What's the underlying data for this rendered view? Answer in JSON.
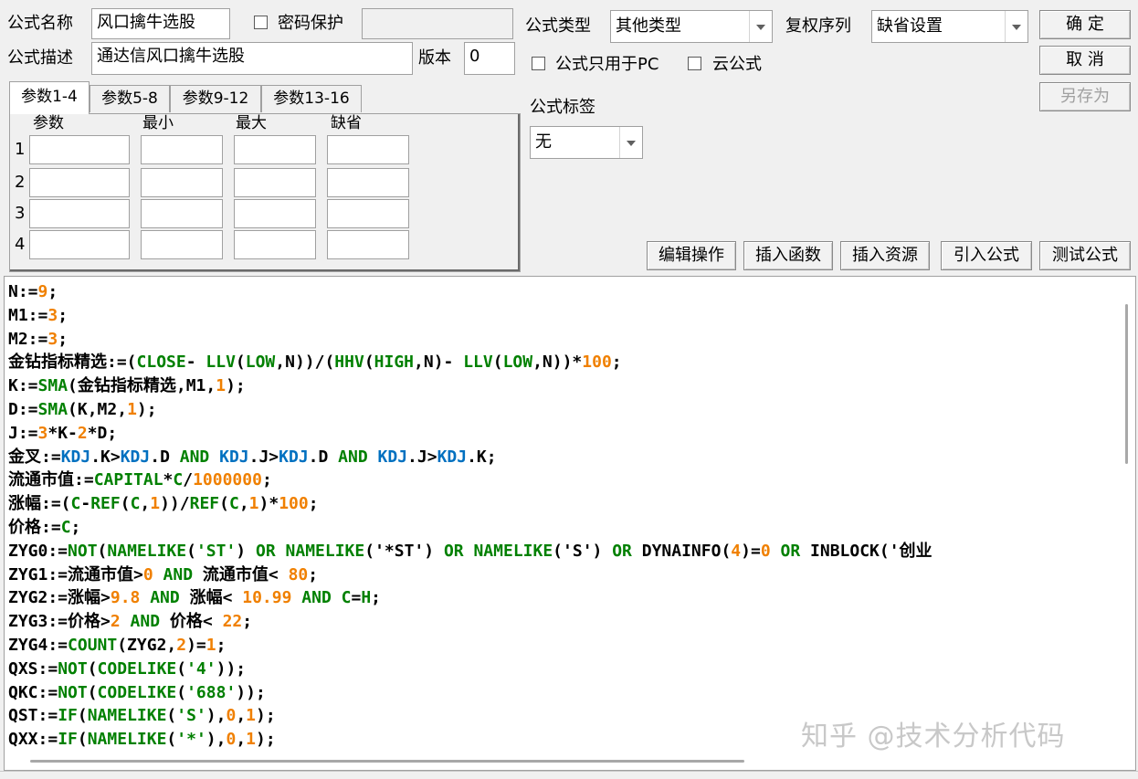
{
  "form": {
    "name_label": "公式名称",
    "name_value": "风口擒牛选股",
    "password_label": "密码保护",
    "password_checked": false,
    "password_value": "",
    "desc_label": "公式描述",
    "desc_value": "通达信风口擒牛选股",
    "version_label": "版本",
    "version_value": "0",
    "type_label": "公式类型",
    "type_value": "其他类型",
    "rights_label": "复权序列",
    "rights_value": "缺省设置",
    "pc_only_label": "公式只用于PC",
    "pc_only_checked": false,
    "cloud_label": "云公式",
    "cloud_checked": false,
    "tag_label": "公式标签",
    "tag_value": "无"
  },
  "buttons": {
    "ok": "确 定",
    "cancel": "取 消",
    "save_as": "另存为",
    "edit_ops": "编辑操作",
    "insert_func": "插入函数",
    "insert_res": "插入资源",
    "import_formula": "引入公式",
    "test_formula": "测试公式"
  },
  "tabs": [
    "参数1-4",
    "参数5-8",
    "参数9-12",
    "参数13-16"
  ],
  "params": {
    "headers": [
      "参数",
      "最小",
      "最大",
      "缺省"
    ],
    "rows": [
      "1",
      "2",
      "3",
      "4"
    ]
  },
  "colors": {
    "default": "#000000",
    "number": "#f08000",
    "function": "#008000",
    "keyword": "#008000",
    "variable": "#0070c0",
    "string": "#008000"
  },
  "code_lines": [
    [
      [
        "N:=",
        "default"
      ],
      [
        "9",
        "number"
      ],
      [
        ";",
        "default"
      ]
    ],
    [
      [
        "M1:=",
        "default"
      ],
      [
        "3",
        "number"
      ],
      [
        ";",
        "default"
      ]
    ],
    [
      [
        "M2:=",
        "default"
      ],
      [
        "3",
        "number"
      ],
      [
        ";",
        "default"
      ]
    ],
    [
      [
        "金钻指标精选:=(",
        "default"
      ],
      [
        "CLOSE",
        "function"
      ],
      [
        "- ",
        "default"
      ],
      [
        "LLV",
        "function"
      ],
      [
        "(",
        "default"
      ],
      [
        "LOW",
        "function"
      ],
      [
        ",N))/(",
        "default"
      ],
      [
        "HHV",
        "function"
      ],
      [
        "(",
        "default"
      ],
      [
        "HIGH",
        "function"
      ],
      [
        ",N)- ",
        "default"
      ],
      [
        "LLV",
        "function"
      ],
      [
        "(",
        "default"
      ],
      [
        "LOW",
        "function"
      ],
      [
        ",N))*",
        "default"
      ],
      [
        "100",
        "number"
      ],
      [
        ";",
        "default"
      ]
    ],
    [
      [
        "K:=",
        "default"
      ],
      [
        "SMA",
        "function"
      ],
      [
        "(金钻指标精选,M1,",
        "default"
      ],
      [
        "1",
        "number"
      ],
      [
        ");",
        "default"
      ]
    ],
    [
      [
        "D:=",
        "default"
      ],
      [
        "SMA",
        "function"
      ],
      [
        "(K,M2,",
        "default"
      ],
      [
        "1",
        "number"
      ],
      [
        ");",
        "default"
      ]
    ],
    [
      [
        "J:=",
        "default"
      ],
      [
        "3",
        "number"
      ],
      [
        "*K-",
        "default"
      ],
      [
        "2",
        "number"
      ],
      [
        "*D;",
        "default"
      ]
    ],
    [
      [
        "金叉:=",
        "default"
      ],
      [
        "KDJ",
        "variable"
      ],
      [
        ".K>",
        "default"
      ],
      [
        "KDJ",
        "variable"
      ],
      [
        ".D ",
        "default"
      ],
      [
        "AND",
        "keyword"
      ],
      [
        " ",
        "default"
      ],
      [
        "KDJ",
        "variable"
      ],
      [
        ".J>",
        "default"
      ],
      [
        "KDJ",
        "variable"
      ],
      [
        ".D ",
        "default"
      ],
      [
        "AND",
        "keyword"
      ],
      [
        " ",
        "default"
      ],
      [
        "KDJ",
        "variable"
      ],
      [
        ".J>",
        "default"
      ],
      [
        "KDJ",
        "variable"
      ],
      [
        ".K;",
        "default"
      ]
    ],
    [
      [
        "流通市值:=",
        "default"
      ],
      [
        "CAPITAL",
        "function"
      ],
      [
        "*",
        "default"
      ],
      [
        "C",
        "function"
      ],
      [
        "/",
        "default"
      ],
      [
        "1000000",
        "number"
      ],
      [
        ";",
        "default"
      ]
    ],
    [
      [
        "涨幅:=(",
        "default"
      ],
      [
        "C",
        "function"
      ],
      [
        "-",
        "default"
      ],
      [
        "REF",
        "function"
      ],
      [
        "(",
        "default"
      ],
      [
        "C",
        "function"
      ],
      [
        ",",
        "default"
      ],
      [
        "1",
        "number"
      ],
      [
        "))/",
        "default"
      ],
      [
        "REF",
        "function"
      ],
      [
        "(",
        "default"
      ],
      [
        "C",
        "function"
      ],
      [
        ",",
        "default"
      ],
      [
        "1",
        "number"
      ],
      [
        ")*",
        "default"
      ],
      [
        "100",
        "number"
      ],
      [
        ";",
        "default"
      ]
    ],
    [
      [
        "价格:=",
        "default"
      ],
      [
        "C",
        "function"
      ],
      [
        ";",
        "default"
      ]
    ],
    [
      [
        "ZYG0:=",
        "default"
      ],
      [
        "NOT",
        "function"
      ],
      [
        "(",
        "default"
      ],
      [
        "NAMELIKE",
        "function"
      ],
      [
        "(",
        "default"
      ],
      [
        "'ST'",
        "string"
      ],
      [
        ") ",
        "default"
      ],
      [
        "OR",
        "keyword"
      ],
      [
        " ",
        "default"
      ],
      [
        "NAMELIKE",
        "function"
      ],
      [
        "(",
        "default"
      ],
      [
        "'*ST'",
        "default"
      ],
      [
        ") ",
        "default"
      ],
      [
        "OR",
        "keyword"
      ],
      [
        " ",
        "default"
      ],
      [
        "NAMELIKE",
        "function"
      ],
      [
        "(",
        "default"
      ],
      [
        "'S'",
        "default"
      ],
      [
        ") ",
        "default"
      ],
      [
        "OR",
        "keyword"
      ],
      [
        " DYNAINFO(",
        "default"
      ],
      [
        "4",
        "number"
      ],
      [
        ")=",
        "default"
      ],
      [
        "0",
        "number"
      ],
      [
        " ",
        "default"
      ],
      [
        "OR",
        "keyword"
      ],
      [
        " INBLOCK('创业",
        "default"
      ]
    ],
    [
      [
        "ZYG1:=流通市值>",
        "default"
      ],
      [
        "0",
        "number"
      ],
      [
        " ",
        "default"
      ],
      [
        "AND",
        "keyword"
      ],
      [
        " 流通市值< ",
        "default"
      ],
      [
        "80",
        "number"
      ],
      [
        ";",
        "default"
      ]
    ],
    [
      [
        "ZYG2:=涨幅>",
        "default"
      ],
      [
        "9.8",
        "number"
      ],
      [
        " ",
        "default"
      ],
      [
        "AND",
        "keyword"
      ],
      [
        " 涨幅< ",
        "default"
      ],
      [
        "10.99",
        "number"
      ],
      [
        " ",
        "default"
      ],
      [
        "AND",
        "keyword"
      ],
      [
        " ",
        "default"
      ],
      [
        "C",
        "function"
      ],
      [
        "=",
        "default"
      ],
      [
        "H",
        "function"
      ],
      [
        ";",
        "default"
      ]
    ],
    [
      [
        "ZYG3:=价格>",
        "default"
      ],
      [
        "2",
        "number"
      ],
      [
        " ",
        "default"
      ],
      [
        "AND",
        "keyword"
      ],
      [
        " 价格< ",
        "default"
      ],
      [
        "22",
        "number"
      ],
      [
        ";",
        "default"
      ]
    ],
    [
      [
        "ZYG4:=",
        "default"
      ],
      [
        "COUNT",
        "function"
      ],
      [
        "(ZYG2,",
        "default"
      ],
      [
        "2",
        "number"
      ],
      [
        ")=",
        "default"
      ],
      [
        "1",
        "number"
      ],
      [
        ";",
        "default"
      ]
    ],
    [
      [
        "QXS:=",
        "default"
      ],
      [
        "NOT",
        "function"
      ],
      [
        "(",
        "default"
      ],
      [
        "CODELIKE",
        "function"
      ],
      [
        "(",
        "default"
      ],
      [
        "'4'",
        "string"
      ],
      [
        "));",
        "default"
      ]
    ],
    [
      [
        "QKC:=",
        "default"
      ],
      [
        "NOT",
        "function"
      ],
      [
        "(",
        "default"
      ],
      [
        "CODELIKE",
        "function"
      ],
      [
        "(",
        "default"
      ],
      [
        "'688'",
        "string"
      ],
      [
        "));",
        "default"
      ]
    ],
    [
      [
        "QST:=",
        "default"
      ],
      [
        "IF",
        "function"
      ],
      [
        "(",
        "default"
      ],
      [
        "NAMELIKE",
        "function"
      ],
      [
        "(",
        "default"
      ],
      [
        "'S'",
        "string"
      ],
      [
        "),",
        "default"
      ],
      [
        "0",
        "number"
      ],
      [
        ",",
        "default"
      ],
      [
        "1",
        "number"
      ],
      [
        ");",
        "default"
      ]
    ],
    [
      [
        "QXX:=",
        "default"
      ],
      [
        "IF",
        "function"
      ],
      [
        "(",
        "default"
      ],
      [
        "NAMELIKE",
        "function"
      ],
      [
        "(",
        "default"
      ],
      [
        "'*'",
        "string"
      ],
      [
        "),",
        "default"
      ],
      [
        "0",
        "number"
      ],
      [
        ",",
        "default"
      ],
      [
        "1",
        "number"
      ],
      [
        ");",
        "default"
      ]
    ]
  ],
  "watermark": "知乎 @技术分析代码"
}
